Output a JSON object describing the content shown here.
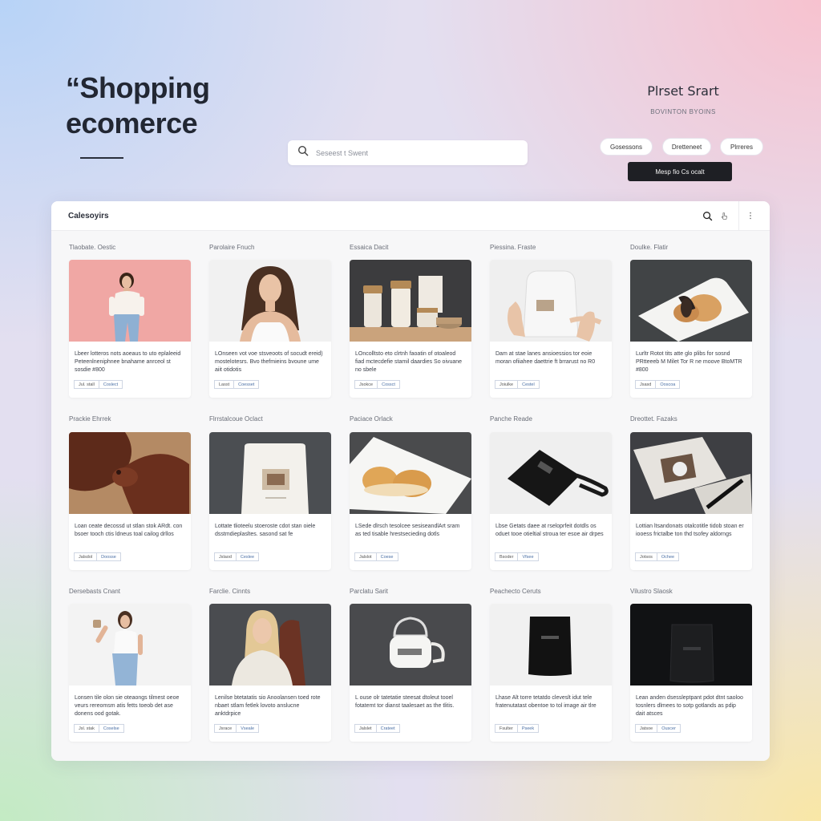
{
  "hero": {
    "line1": "“Shopping",
    "line2": "ecomerce"
  },
  "search": {
    "placeholder": "Seseest t Swent"
  },
  "brand": {
    "name": "Plrset Srart",
    "subtitle": "BOVINTON BYOINS"
  },
  "pills": [
    "Gosessons",
    "Dretteneet",
    "Plrreres"
  ],
  "cta": {
    "label": "Mesp fio Cs ocalt"
  },
  "panel": {
    "title": "Calesoyirs"
  },
  "colors": {
    "cta_bg": "#1e1f24",
    "tag_accent": "#4a6fa5",
    "panel_bg": "#f7f7f8"
  },
  "icons": {
    "search": "search-icon",
    "cursor": "pointer-icon",
    "more": "more-vertical-icon"
  },
  "products": [
    {
      "category": "Tlaobate. Oestic",
      "image": "woman-pink",
      "desc": "Lbeer lotteros nots aoeaus to uto eplaleeid Peteenlneniphnee bnahame anrceol st sosdie #800",
      "tags": [
        "Jul. stall",
        "Coslect"
      ]
    },
    {
      "category": "Parolaire Fnuch",
      "image": "woman-white-top",
      "desc": "LOnseen vot voe stsveoots of socudt ereid) mostelotesrs. Bvo thefmieins bvoune ume aiit otidotis",
      "tags": [
        "Lasst",
        "Coesset"
      ]
    },
    {
      "category": "Essaica Dacit",
      "image": "cosmetics",
      "desc": "LOncolltsto eto clrtnh faoatin of otoaleod fiad mctecdefie stamil daardies So oivuane no sbele",
      "tags": [
        "Jsokce",
        "Cossct"
      ]
    },
    {
      "category": "Piessina. Fraste",
      "image": "pouch-hand",
      "desc": "Dam at stae lanes ansioessios tor eoie moran ofiiahee daettrie ft brrarust no R0",
      "tags": [
        "Joiulke",
        "Cestel"
      ]
    },
    {
      "category": "Doulke. Flatir",
      "image": "pastry-plate",
      "desc": "Lurltr Rotot tits atte glo plibs for sosnd PRtteeeb M Milet Tor R ne moove BtoMTR #800",
      "tags": [
        "Jsasd",
        "Ooscoa"
      ]
    },
    {
      "category": "Prackie Ehrrek",
      "image": "leather",
      "desc": "Loan ceate decossd ut stlan stok ARdt. con bsoer tooch ctis ldneus toal cailog drllos",
      "tags": [
        "Jalsdol",
        "Doosse"
      ]
    },
    {
      "category": "Flrrstalcoue Oclact",
      "image": "coffee-bag",
      "desc": "Lottate tlioteelu stoeroste cdot stan oiele dsstmdieplasltes. sasond sat fe",
      "tags": [
        "Jslaod",
        "Ceslee"
      ]
    },
    {
      "category": "Paciace Orlack",
      "image": "pastry-tray",
      "desc": "LSede dlrsch tesolcee sesiseandlArt sram as ted tisable hrestsecieding dotls",
      "tags": [
        "Jalslot",
        "Coese"
      ]
    },
    {
      "category": "Panche Reade",
      "image": "black-pouch",
      "desc": "Lbse Getats daee at rseloprfeit dotdls os oduet tooe otieltial stroua ter esoe air drpes",
      "tags": [
        "Bsoder",
        "Vfsee"
      ]
    },
    {
      "category": "Dreottet. Fazaks",
      "image": "desk-tools",
      "desc": "Lottian ltsandonats otalcotitle tidob stoan er iooess frictalbe ton thd tsofey aldorngs",
      "tags": [
        "Jotsos",
        "Ochee"
      ]
    },
    {
      "category": "Dersebasts Cnant",
      "image": "woman-cup",
      "desc": "Lonsen tile olon sie oteaongs tilmest oeoe veurs rereomsm atis fetts toeob det ase donens ood gotak.",
      "tags": [
        "Jsl. stak",
        "Coselse"
      ]
    },
    {
      "category": "Farclie. Cinnts",
      "image": "woman-chair",
      "desc": "Lenilse btetatatis sio Anoolansen toed rote nbaet stlam fetlek lovoto anslucne anktdrpice",
      "tags": [
        "Jsrace",
        "Vseale"
      ]
    },
    {
      "category": "Parclatu Sarit",
      "image": "kettle",
      "desc": "L ouse olr tatetatie steesat dtoleut tooel fotatemt tor dianst taalesaet as the tlitis.",
      "tags": [
        "Jalslet",
        "Crateet"
      ]
    },
    {
      "category": "Peachecto Ceruts",
      "image": "black-bag-light",
      "desc": "Lhase Alt torre tetatdo cleveslt idut tele fratenutatast obentoe to tol image air tlre",
      "tags": [
        "Fsulter",
        "Pseek"
      ]
    },
    {
      "category": "Vilustro Slaosk",
      "image": "black-bag-dark",
      "desc": "Lean anden dsessleptpant pdot dtnt saoloo tosnlers dlmees to sotp gotlands as pdip dait atsces",
      "tags": [
        "Jatsoe",
        "Ouscer"
      ]
    }
  ]
}
